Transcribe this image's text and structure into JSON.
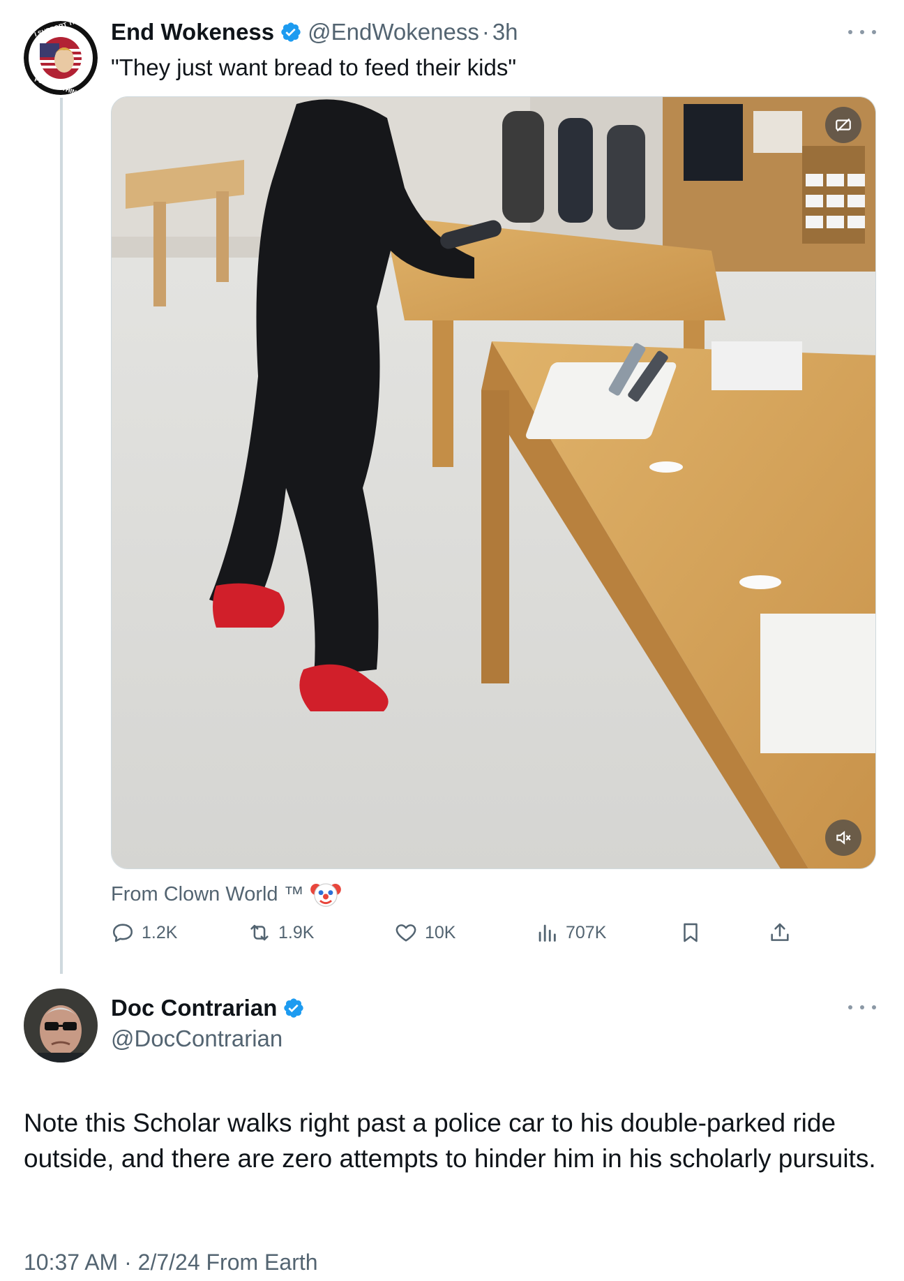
{
  "parent_tweet": {
    "display_name": "End Wokeness",
    "handle": "@EndWokeness",
    "time_separator": "·",
    "time": "3h",
    "text": "\"They just want bread to feed their kids\"",
    "avatar_badge_top": "I SUPPORT THE",
    "avatar_badge_bottom": "FORMER THINGS",
    "source_text": "From Clown World ™",
    "source_emoji": "clown-face",
    "stats": {
      "replies": "1.2K",
      "reposts": "1.9K",
      "likes": "10K",
      "views": "707K"
    }
  },
  "reply_tweet": {
    "display_name": "Doc Contrarian",
    "handle": "@DocContrarian",
    "text": "Note this Scholar walks right past a police car to his double-parked ride outside, and there are zero attempts to hinder him in his scholarly pursuits.",
    "timestamp": "10:37 AM · 2/7/24 From Earth"
  },
  "icons": {
    "verified": "verified-badge-icon",
    "more": "more-icon",
    "reply": "reply-icon",
    "repost": "repost-icon",
    "like": "like-icon",
    "views": "views-icon",
    "bookmark": "bookmark-icon",
    "share": "share-icon",
    "caption": "captions-off-icon",
    "mute": "mute-icon"
  },
  "colors": {
    "verified_blue": "#1d9bf0",
    "text_primary": "#0f1419",
    "text_secondary": "#536471",
    "thread_line": "#cfd9de"
  }
}
